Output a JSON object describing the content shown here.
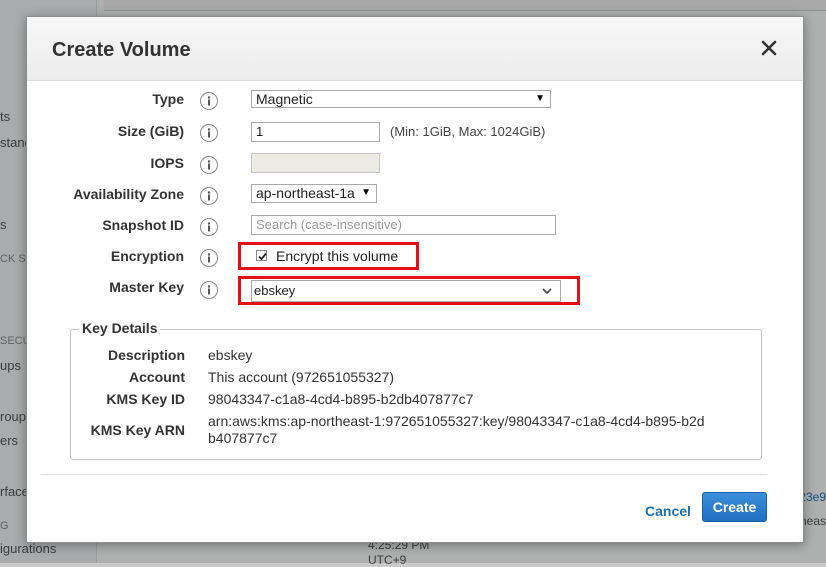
{
  "background": {
    "sidebar_items": [
      "ts",
      "stanc",
      "s",
      "CK S",
      "SECU",
      "ups",
      "roup",
      "ers",
      "rface",
      "G",
      "igurations"
    ],
    "right_snippets": [
      "23e9",
      "neas"
    ],
    "bottom_snippets": [
      "4:25:29 PM",
      "UTC+9"
    ]
  },
  "modal": {
    "title": "Create Volume",
    "close_label": "×",
    "fields": {
      "type": {
        "label": "Type",
        "value": "Magnetic"
      },
      "size": {
        "label": "Size (GiB)",
        "value": "1",
        "hint": "(Min: 1GiB, Max: 1024GiB)"
      },
      "iops": {
        "label": "IOPS",
        "value": ""
      },
      "availability_zone": {
        "label": "Availability Zone",
        "value": "ap-northeast-1a"
      },
      "snapshot_id": {
        "label": "Snapshot ID",
        "placeholder": "Search (case-insensitive)"
      },
      "encryption": {
        "label": "Encryption",
        "checkbox_label": "Encrypt this volume",
        "checked": true
      },
      "master_key": {
        "label": "Master Key",
        "value": "ebskey"
      }
    },
    "key_details": {
      "legend": "Key Details",
      "rows": [
        {
          "label": "Description",
          "value": "ebskey"
        },
        {
          "label": "Account",
          "value": "This account (972651055327)"
        },
        {
          "label": "KMS Key ID",
          "value": "98043347-c1a8-4cd4-b895-b2db407877c7"
        },
        {
          "label": "KMS Key ARN",
          "value": "arn:aws:kms:ap-northeast-1:972651055327:key/98043347-c1a8-4cd4-b895-b2db407877c7"
        }
      ]
    },
    "buttons": {
      "cancel": "Cancel",
      "create": "Create"
    }
  },
  "colors": {
    "highlight": "#e3101a",
    "primary_button": "#1f6fbf",
    "link": "#1a6fb7"
  }
}
